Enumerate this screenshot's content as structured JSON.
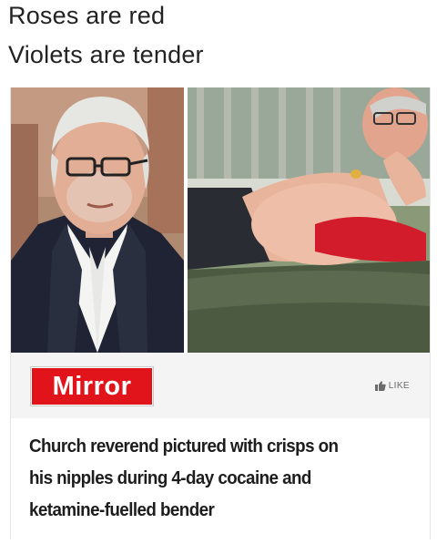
{
  "caption": {
    "line1": "Roses are red",
    "line2": "Violets are tender"
  },
  "card": {
    "publisher_logo": "Mirror",
    "like_label": "LIKE",
    "like_icon": "thumbs-up-icon",
    "headline_lines": [
      "Church reverend pictured with crisps on",
      "his nipples during 4-day cocaine and",
      "ketamine-fuelled bender"
    ]
  },
  "colors": {
    "brand_red": "#e1141b",
    "background": "#ffffff",
    "card_bar": "#f4f4f4",
    "headline_text": "#1d1d1d"
  }
}
